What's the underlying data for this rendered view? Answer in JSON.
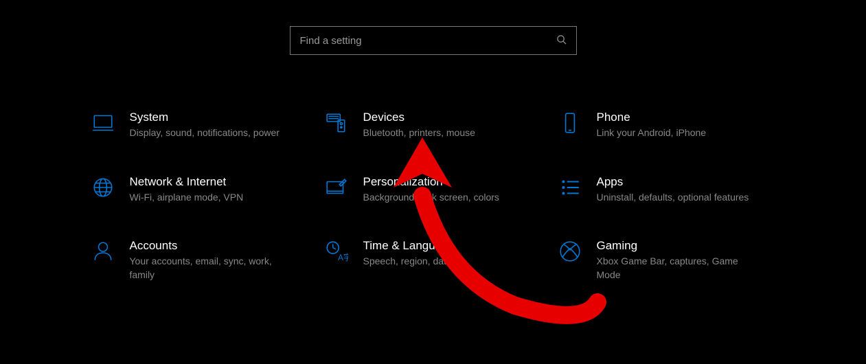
{
  "search": {
    "placeholder": "Find a setting"
  },
  "categories": [
    {
      "title": "System",
      "desc": "Display, sound, notifications, power"
    },
    {
      "title": "Devices",
      "desc": "Bluetooth, printers, mouse"
    },
    {
      "title": "Phone",
      "desc": "Link your Android, iPhone"
    },
    {
      "title": "Network & Internet",
      "desc": "Wi-Fi, airplane mode, VPN"
    },
    {
      "title": "Personalization",
      "desc": "Background, lock screen, colors"
    },
    {
      "title": "Apps",
      "desc": "Uninstall, defaults, optional features"
    },
    {
      "title": "Accounts",
      "desc": "Your accounts, email, sync, work, family"
    },
    {
      "title": "Time & Language",
      "desc": "Speech, region, date"
    },
    {
      "title": "Gaming",
      "desc": "Xbox Game Bar, captures, Game Mode"
    }
  ]
}
